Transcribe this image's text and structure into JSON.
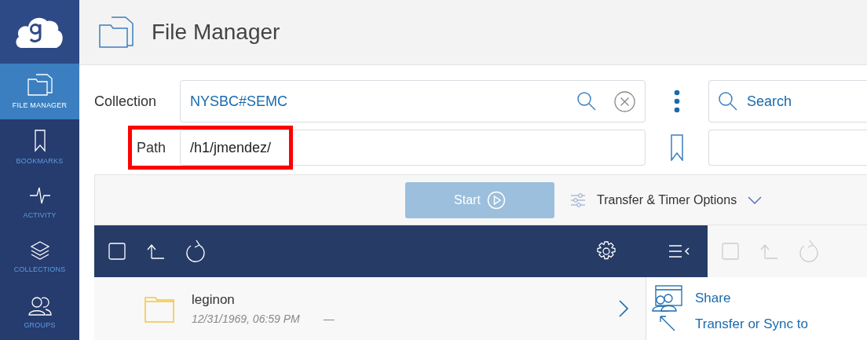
{
  "sidebar": {
    "items": [
      {
        "label": "FILE MANAGER",
        "selected": true
      },
      {
        "label": "BOOKMARKS",
        "selected": false
      },
      {
        "label": "ACTIVITY",
        "selected": false
      },
      {
        "label": "COLLECTIONS",
        "selected": false
      },
      {
        "label": "GROUPS",
        "selected": false
      }
    ]
  },
  "header": {
    "title": "File Manager"
  },
  "collection": {
    "label": "Collection",
    "value": "NYSBC#SEMC"
  },
  "path": {
    "label": "Path",
    "value": "/h1/jmendez/",
    "highlighted": true
  },
  "right_search": {
    "placeholder": "Search"
  },
  "start_button": {
    "label": "Start",
    "disabled": true
  },
  "transfer_options": {
    "label": "Transfer & Timer Options",
    "expanded": false
  },
  "file_list": [
    {
      "name": "leginon",
      "modified": "12/31/1969, 06:59 PM",
      "size": "—"
    }
  ],
  "actions": [
    {
      "label": "Share"
    },
    {
      "label": "Transfer or Sync to"
    }
  ]
}
